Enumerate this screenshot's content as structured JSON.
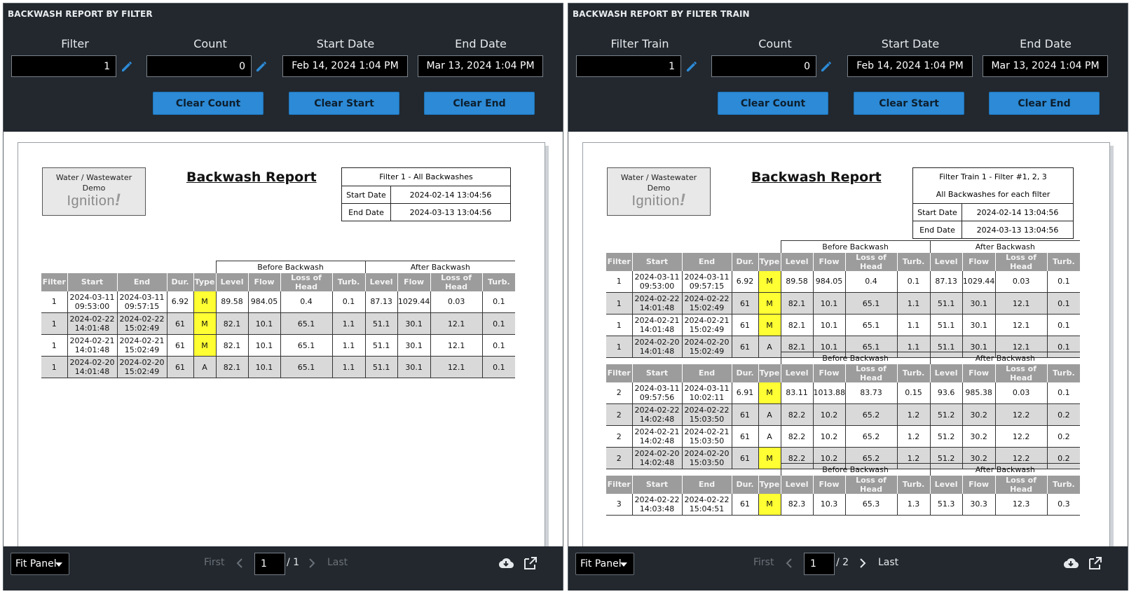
{
  "colors": {
    "header_bg": "#22282e",
    "button": "#2c8ad6",
    "type_m_highlight": "#ffff33",
    "table_header": "#9c9c9c",
    "row_alt": "#d9d9d9"
  },
  "common": {
    "clear_count": "Clear Count",
    "clear_start": "Clear Start",
    "clear_end": "Clear End",
    "fit_panel": "Fit Panel",
    "first": "First",
    "last": "Last",
    "logo_line1": "Water / Wastewater",
    "logo_line2": "Demo",
    "logo_word": "Ignition",
    "before_backwash": "Before Backwash",
    "after_backwash": "After Backwash",
    "report_title": "Backwash Report",
    "start_date_label": "Start Date",
    "end_date_label": "End Date",
    "count_label": "Count",
    "start_date_field": "Start Date",
    "end_date_field": "End Date"
  },
  "columns": [
    "Filter",
    "Start",
    "End",
    "Dur.",
    "Type",
    "Level",
    "Flow",
    "Loss of Head",
    "Turb.",
    "Level",
    "Flow",
    "Loss of Head",
    "Turb."
  ],
  "left": {
    "title": "BACKWASH REPORT BY FILTER",
    "filter_label": "Filter",
    "filter_value": "1",
    "count_value": "0",
    "start_date": "Feb 14, 2024 1:04 PM",
    "end_date": "Mar 13, 2024 1:04 PM",
    "info_title": "Filter 1 - All Backwashes",
    "info_start": "2024-02-14 13:04:56",
    "info_end": "2024-03-13 13:04:56",
    "page_value": "1",
    "page_total": "/ 1",
    "tables": [
      {
        "rows": [
          {
            "filter": "1",
            "start_d": "2024-03-11",
            "start_t": "09:53:00",
            "end_d": "2024-03-11",
            "end_t": "09:57:15",
            "dur": "6.92",
            "type": "M",
            "b_level": "89.58",
            "b_flow": "984.05",
            "b_loh": "0.4",
            "b_turb": "0.1",
            "a_level": "87.13",
            "a_flow": "1029.44",
            "a_loh": "0.03",
            "a_turb": "0.1"
          },
          {
            "filter": "1",
            "start_d": "2024-02-22",
            "start_t": "14:01:48",
            "end_d": "2024-02-22",
            "end_t": "15:02:49",
            "dur": "61",
            "type": "M",
            "b_level": "82.1",
            "b_flow": "10.1",
            "b_loh": "65.1",
            "b_turb": "1.1",
            "a_level": "51.1",
            "a_flow": "30.1",
            "a_loh": "12.1",
            "a_turb": "0.1"
          },
          {
            "filter": "1",
            "start_d": "2024-02-21",
            "start_t": "14:01:48",
            "end_d": "2024-02-21",
            "end_t": "15:02:49",
            "dur": "61",
            "type": "M",
            "b_level": "82.1",
            "b_flow": "10.1",
            "b_loh": "65.1",
            "b_turb": "1.1",
            "a_level": "51.1",
            "a_flow": "30.1",
            "a_loh": "12.1",
            "a_turb": "0.1"
          },
          {
            "filter": "1",
            "start_d": "2024-02-20",
            "start_t": "14:01:48",
            "end_d": "2024-02-20",
            "end_t": "15:02:49",
            "dur": "61",
            "type": "A",
            "b_level": "82.1",
            "b_flow": "10.1",
            "b_loh": "65.1",
            "b_turb": "1.1",
            "a_level": "51.1",
            "a_flow": "30.1",
            "a_loh": "12.1",
            "a_turb": "0.1"
          }
        ]
      }
    ]
  },
  "right": {
    "title": "BACKWASH REPORT BY FILTER TRAIN",
    "filter_label": "Filter Train",
    "filter_value": "1",
    "count_value": "0",
    "start_date": "Feb 14, 2024 1:04 PM",
    "end_date": "Mar 13, 2024 1:04 PM",
    "info_title": "Filter Train 1 - Filter #1, 2, 3",
    "info_subtitle": "All Backwashes for each filter",
    "info_start": "2024-02-14 13:04:56",
    "info_end": "2024-03-13 13:04:56",
    "page_value": "1",
    "page_total": "/ 2",
    "tables": [
      {
        "rows": [
          {
            "filter": "1",
            "start_d": "2024-03-11",
            "start_t": "09:53:00",
            "end_d": "2024-03-11",
            "end_t": "09:57:15",
            "dur": "6.92",
            "type": "M",
            "b_level": "89.58",
            "b_flow": "984.05",
            "b_loh": "0.4",
            "b_turb": "0.1",
            "a_level": "87.13",
            "a_flow": "1029.44",
            "a_loh": "0.03",
            "a_turb": "0.1"
          },
          {
            "filter": "1",
            "start_d": "2024-02-22",
            "start_t": "14:01:48",
            "end_d": "2024-02-22",
            "end_t": "15:02:49",
            "dur": "61",
            "type": "M",
            "b_level": "82.1",
            "b_flow": "10.1",
            "b_loh": "65.1",
            "b_turb": "1.1",
            "a_level": "51.1",
            "a_flow": "30.1",
            "a_loh": "12.1",
            "a_turb": "0.1"
          },
          {
            "filter": "1",
            "start_d": "2024-02-21",
            "start_t": "14:01:48",
            "end_d": "2024-02-21",
            "end_t": "15:02:49",
            "dur": "61",
            "type": "M",
            "b_level": "82.1",
            "b_flow": "10.1",
            "b_loh": "65.1",
            "b_turb": "1.1",
            "a_level": "51.1",
            "a_flow": "30.1",
            "a_loh": "12.1",
            "a_turb": "0.1"
          },
          {
            "filter": "1",
            "start_d": "2024-02-20",
            "start_t": "14:01:48",
            "end_d": "2024-02-20",
            "end_t": "15:02:49",
            "dur": "61",
            "type": "A",
            "b_level": "82.1",
            "b_flow": "10.1",
            "b_loh": "65.1",
            "b_turb": "1.1",
            "a_level": "51.1",
            "a_flow": "30.1",
            "a_loh": "12.1",
            "a_turb": "0.1"
          }
        ]
      },
      {
        "rows": [
          {
            "filter": "2",
            "start_d": "2024-03-11",
            "start_t": "09:57:56",
            "end_d": "2024-03-11",
            "end_t": "10:02:11",
            "dur": "6.91",
            "type": "M",
            "b_level": "83.11",
            "b_flow": "1013.88",
            "b_loh": "83.73",
            "b_turb": "0.15",
            "a_level": "93.6",
            "a_flow": "985.38",
            "a_loh": "0.03",
            "a_turb": "0.1"
          },
          {
            "filter": "2",
            "start_d": "2024-02-22",
            "start_t": "14:02:48",
            "end_d": "2024-02-22",
            "end_t": "15:03:50",
            "dur": "61",
            "type": "A",
            "b_level": "82.2",
            "b_flow": "10.2",
            "b_loh": "65.2",
            "b_turb": "1.2",
            "a_level": "51.2",
            "a_flow": "30.2",
            "a_loh": "12.2",
            "a_turb": "0.2"
          },
          {
            "filter": "2",
            "start_d": "2024-02-21",
            "start_t": "14:02:48",
            "end_d": "2024-02-21",
            "end_t": "15:03:50",
            "dur": "61",
            "type": "A",
            "b_level": "82.2",
            "b_flow": "10.2",
            "b_loh": "65.2",
            "b_turb": "1.2",
            "a_level": "51.2",
            "a_flow": "30.2",
            "a_loh": "12.2",
            "a_turb": "0.2"
          },
          {
            "filter": "2",
            "start_d": "2024-02-20",
            "start_t": "14:02:48",
            "end_d": "2024-02-20",
            "end_t": "15:03:50",
            "dur": "61",
            "type": "M",
            "b_level": "82.2",
            "b_flow": "10.2",
            "b_loh": "65.2",
            "b_turb": "1.2",
            "a_level": "51.2",
            "a_flow": "30.2",
            "a_loh": "12.2",
            "a_turb": "0.2"
          }
        ]
      },
      {
        "rows": [
          {
            "filter": "3",
            "start_d": "2024-02-22",
            "start_t": "14:03:48",
            "end_d": "2024-02-22",
            "end_t": "15:04:51",
            "dur": "61",
            "type": "M",
            "b_level": "82.3",
            "b_flow": "10.3",
            "b_loh": "65.3",
            "b_turb": "1.3",
            "a_level": "51.3",
            "a_flow": "30.3",
            "a_loh": "12.3",
            "a_turb": "0.3"
          }
        ]
      }
    ]
  }
}
